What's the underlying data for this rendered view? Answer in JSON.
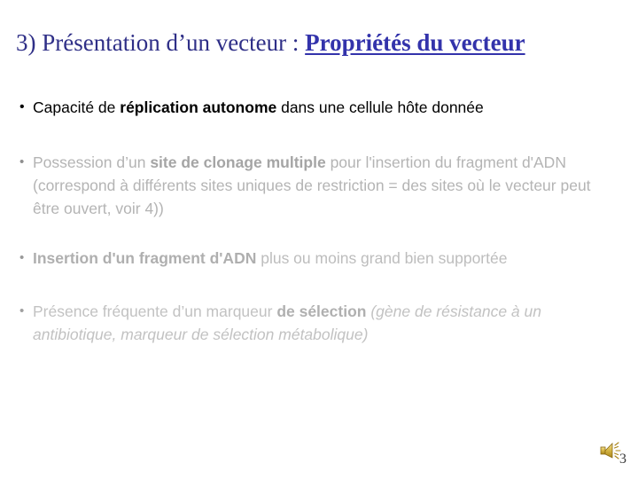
{
  "slide": {
    "title": {
      "plain": "3) Présentation d’un vecteur : ",
      "emphasis": "Propriétés du vecteur",
      "plain_color": "#2f2f87",
      "emphasis_color": "#3333ab"
    },
    "bullets": [
      {
        "marker": "•",
        "color": "#000000",
        "segments_text": "• Capacité de réplication autonome dans une cellule hôte donnée",
        "part_a": "Capacité de ",
        "bold_a": "réplication autonome",
        "part_b": " dans une cellule hôte donnée"
      },
      {
        "marker": "•",
        "color": "#b4b4b4",
        "segments_text": "• Possession d’un site  de clonage multiple pour l'insertion du fragment d'ADN (correspond à différents sites uniques de restriction = des sites où le vecteur peut être ouvert, voir 4))",
        "part_a": "Possession d’un ",
        "bold_a": "site  de clonage multiple",
        "part_b": " pour l'insertion du fragment d'ADN (correspond à différents sites uniques de restriction = des sites où le vecteur peut être ouvert, voir 4))"
      },
      {
        "marker": "•",
        "color": "#bdbdbd",
        "segments_text": "• Insertion d'un fragment d'ADN plus ou moins grand bien supportée",
        "part_a": "",
        "bold_a": "Insertion d'un fragment d'ADN",
        "part_b": " plus ou moins grand bien supportée"
      },
      {
        "marker": "•",
        "color": "#c2c2c2",
        "segments_text": "• Présence fréquente d’un marqueur de sélection (gène de résistance à un antibiotique, marqueur de sélection métabolique)",
        "part_a": "Présence fréquente d’un marqueur ",
        "bold_a": "de sélection",
        "part_b": " ",
        "italic_c": "(gène de résistance à un antibiotique, marqueur de sélection métabolique)"
      }
    ],
    "footer": {
      "slide_number": "3",
      "sound_icon_name": "sound-speaker-icon",
      "sound_icon_color": "#c8a632"
    }
  }
}
